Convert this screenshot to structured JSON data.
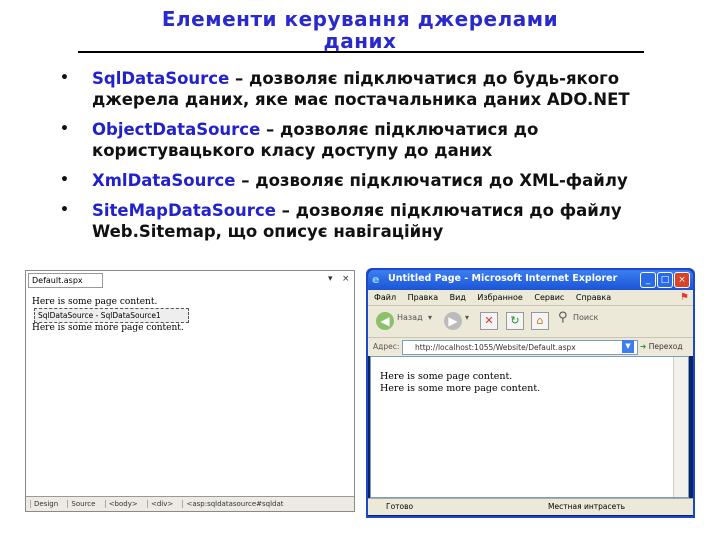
{
  "slide": {
    "title_line1": "Елементи керування джерелами",
    "title_line2": "даних",
    "bullets": [
      {
        "term": "SqlDataSource",
        "text": " – дозволяє підключатися до будь-якого джерела даних, яке має постачальника даних ADO.NET"
      },
      {
        "term": "ObjectDataSource",
        "text": " – дозволяє підключатися до користувацького класу доступу до даних"
      },
      {
        "term": "XmlDataSource",
        "text": " – дозволяє підключатися до XML-файлу"
      },
      {
        "term": "SiteMapDataSource",
        "text": " – дозволяє підключатися до файлу Web.Sitemap, що описує навігаційну"
      }
    ],
    "bullet_symbol": "•",
    "colors": {
      "term": "#2222cc",
      "title": "#2a2acc"
    }
  },
  "designer": {
    "tab": "Default.aspx",
    "line1": "Here is some page content.",
    "control": "SqlDataSource - SqlDataSource1",
    "line2": "Here is some more page content.",
    "bottom_tabs": [
      "Design",
      "Source",
      "<body>",
      "<div>",
      "<asp:sqldatasource#sqldat"
    ]
  },
  "browser": {
    "title": "Untitled Page - Microsoft Internet Explorer",
    "menu": [
      "Файл",
      "Правка",
      "Вид",
      "Избранное",
      "Сервис",
      "Справка"
    ],
    "toolbar": {
      "back": "Назад",
      "search": "Поиск"
    },
    "address_label": "Адрес:",
    "address": "http://localhost:1055/Website/Default.aspx",
    "go": "Переход",
    "content": [
      "Here is some page content.",
      "Here is some more page content."
    ],
    "status": "Готово",
    "zone": "Местная интрасеть"
  }
}
